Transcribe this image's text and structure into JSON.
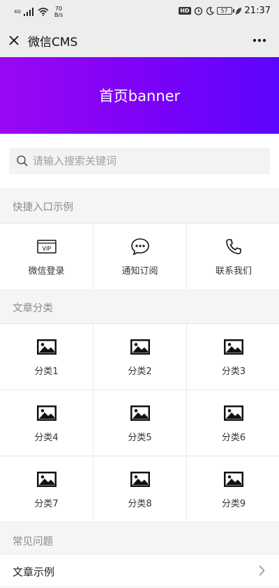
{
  "status_bar": {
    "signal": "4G",
    "net_speed_value": "70",
    "net_speed_unit": "B/s",
    "hd": "HD",
    "battery": "57",
    "time": "21:37"
  },
  "navbar": {
    "title": "微信CMS"
  },
  "banner": {
    "text": "首页banner",
    "colors": [
      "#9a08f2",
      "#5c05ff"
    ]
  },
  "search": {
    "placeholder": "请输入搜索关键词"
  },
  "quick_entry": {
    "title": "快捷入口示例",
    "items": [
      {
        "label": "微信登录",
        "icon": "vip-icon",
        "icon_text": "VIP"
      },
      {
        "label": "通知订阅",
        "icon": "chat-bubble-icon"
      },
      {
        "label": "联系我们",
        "icon": "phone-icon"
      }
    ]
  },
  "categories": {
    "title": "文章分类",
    "items": [
      {
        "label": "分类1",
        "icon": "image-icon"
      },
      {
        "label": "分类2",
        "icon": "image-icon"
      },
      {
        "label": "分类3",
        "icon": "image-icon"
      },
      {
        "label": "分类4",
        "icon": "image-icon"
      },
      {
        "label": "分类5",
        "icon": "image-icon"
      },
      {
        "label": "分类6",
        "icon": "image-icon"
      },
      {
        "label": "分类7",
        "icon": "image-icon"
      },
      {
        "label": "分类8",
        "icon": "image-icon"
      },
      {
        "label": "分类9",
        "icon": "image-icon"
      }
    ]
  },
  "faq": {
    "title": "常见问题",
    "items": [
      {
        "label": "文章示例"
      }
    ]
  }
}
